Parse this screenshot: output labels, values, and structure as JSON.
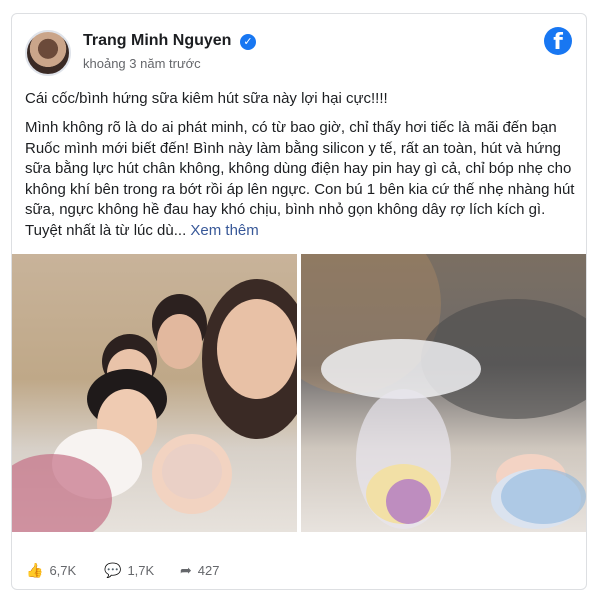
{
  "post": {
    "author": "Trang Minh Nguyen",
    "time": "khoảng 3 năm trước",
    "title": "Cái cốc/bình hứng sữa kiêm hút sữa này lợi hại cực!!!!",
    "body": "Mình không rõ là do ai phát minh, có từ bao giờ, chỉ thấy hơi tiếc là mãi đến bạn Ruốc mình mới biết đến! Bình này làm bằng silicon y tế, rất an toàn, hút và hứng sữa bằng lực hút chân không, không dùng điện hay pin hay gì cả, chỉ bóp nhẹ cho không khí bên trong ra bớt rồi áp lên ngực. Con bú 1 bên kia cứ thế nhẹ nhàng hút sữa, ngực không hề đau hay khó chịu, bình nhỏ gọn không dây rợ lích kích gì. Tuyệt nhất là từ lúc dù... ",
    "see_more": "Xem thêm"
  },
  "stats": {
    "likes": "6,7K",
    "comments": "1,7K",
    "shares": "427"
  },
  "icons": {
    "verified": "verified-badge-icon",
    "facebook": "facebook-logo-icon",
    "like": "thumbs-up-icon",
    "comment": "comment-icon",
    "share": "share-icon"
  },
  "colors": {
    "brand": "#1877f2",
    "link": "#385898",
    "muted": "#65676b"
  }
}
